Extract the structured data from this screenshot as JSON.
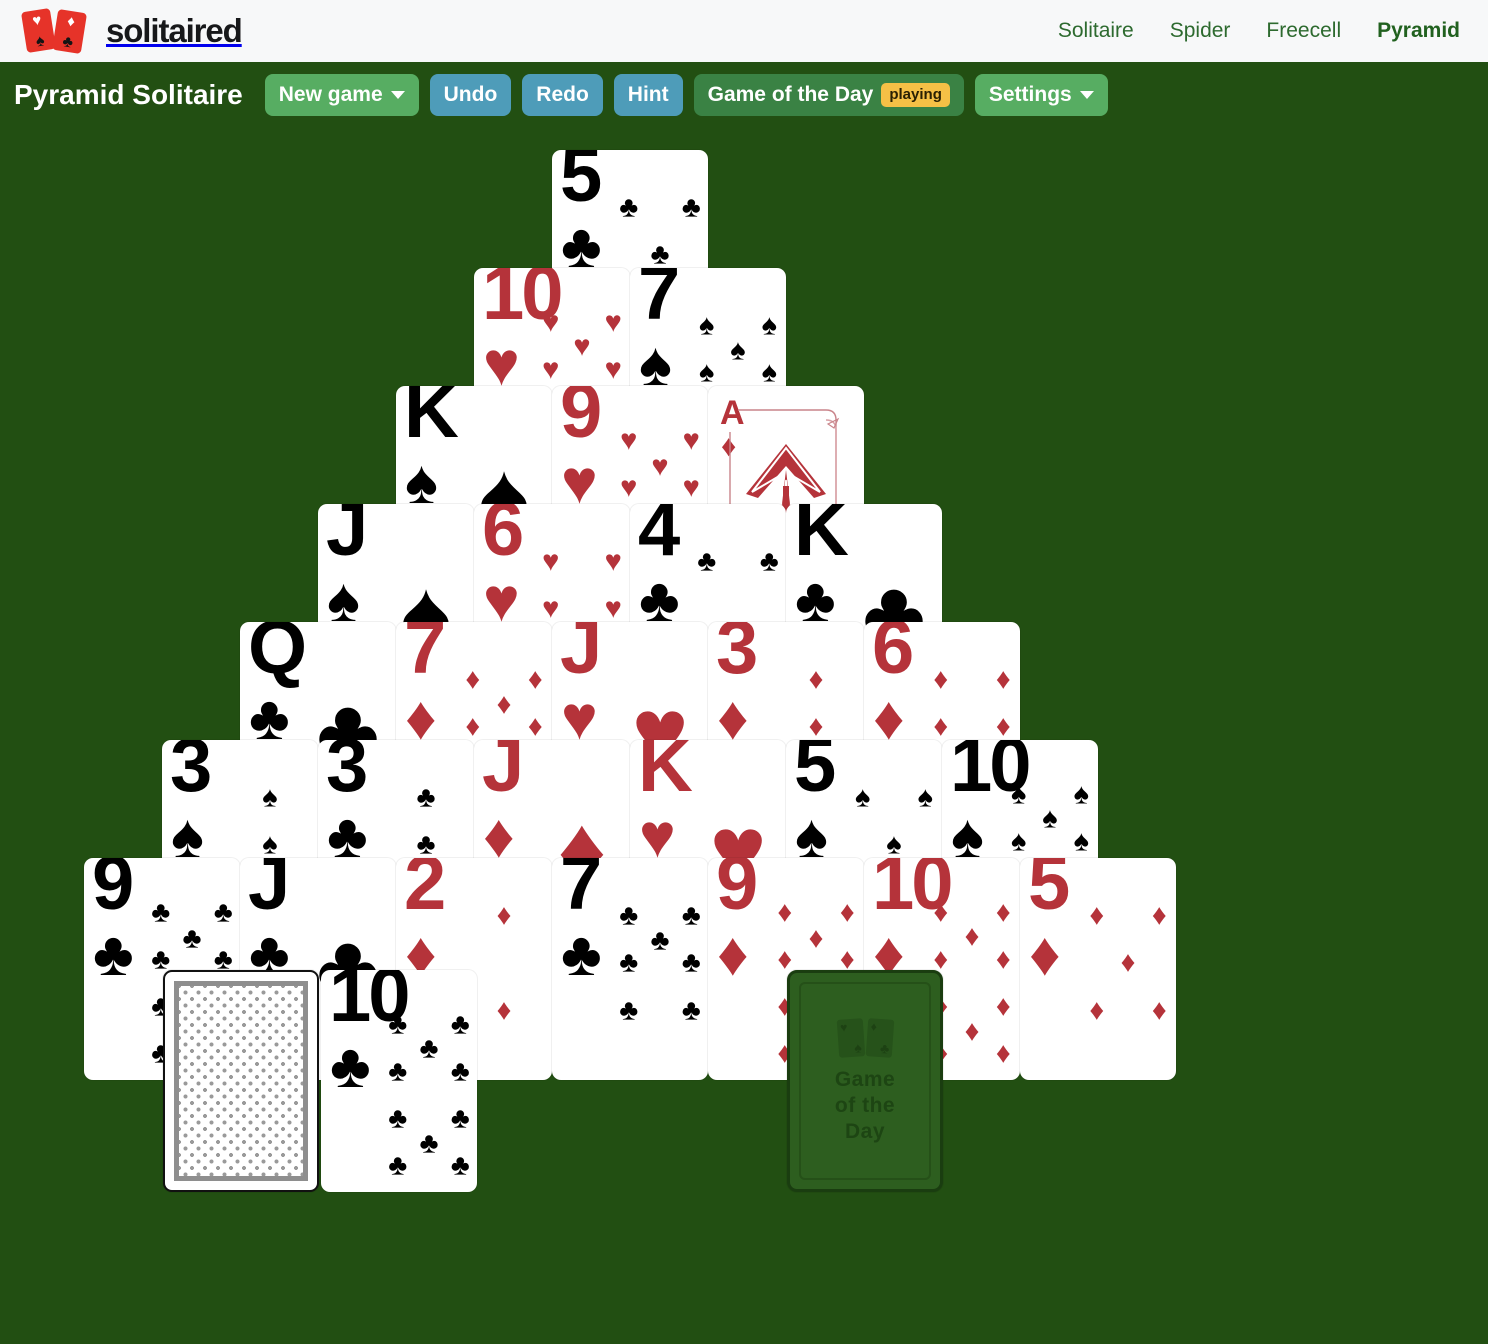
{
  "brand": {
    "name": "solitaired",
    "logo_icon": "two-playing-cards-icon",
    "logo_top_pip": "♥",
    "logo_bottom_pip": "♠",
    "logo_top_pip2": "♦",
    "logo_bottom_pip2": "♣"
  },
  "nav": {
    "links": [
      {
        "label": "Solitaire",
        "active": false
      },
      {
        "label": "Spider",
        "active": false
      },
      {
        "label": "Freecell",
        "active": false
      },
      {
        "label": "Pyramid",
        "active": true
      }
    ]
  },
  "toolbar": {
    "title": "Pyramid Solitaire",
    "new_game_label": "New game",
    "undo_label": "Undo",
    "redo_label": "Redo",
    "hint_label": "Hint",
    "gotd_label": "Game of the Day",
    "gotd_badge": "playing",
    "settings_label": "Settings"
  },
  "colors": {
    "table_green": "#224F12",
    "nav_bg": "#f7f8f9",
    "link_green": "#2d6a2f",
    "btn_green": "#57ad62",
    "btn_green_dark": "#3a8244",
    "btn_blue": "#4e9cb9",
    "badge_yellow": "#f5c046",
    "card_red": "#b5333a",
    "card_black": "#000000",
    "brand_red": "#e63329"
  },
  "game": {
    "type": "pyramid-solitaire",
    "pyramid_rows": 7,
    "rows": [
      [
        {
          "rank": "5",
          "suit": "clubs"
        }
      ],
      [
        {
          "rank": "10",
          "suit": "hearts"
        },
        {
          "rank": "7",
          "suit": "spades"
        }
      ],
      [
        {
          "rank": "K",
          "suit": "spades"
        },
        {
          "rank": "9",
          "suit": "hearts"
        },
        {
          "rank": "A",
          "suit": "diamonds"
        }
      ],
      [
        {
          "rank": "J",
          "suit": "spades"
        },
        {
          "rank": "6",
          "suit": "hearts"
        },
        {
          "rank": "4",
          "suit": "clubs"
        },
        {
          "rank": "K",
          "suit": "clubs"
        }
      ],
      [
        {
          "rank": "Q",
          "suit": "clubs"
        },
        {
          "rank": "7",
          "suit": "diamonds"
        },
        {
          "rank": "J",
          "suit": "hearts"
        },
        {
          "rank": "3",
          "suit": "diamonds"
        },
        {
          "rank": "6",
          "suit": "diamonds"
        }
      ],
      [
        {
          "rank": "3",
          "suit": "spades"
        },
        {
          "rank": "3",
          "suit": "clubs"
        },
        {
          "rank": "J",
          "suit": "diamonds"
        },
        {
          "rank": "K",
          "suit": "hearts"
        },
        {
          "rank": "5",
          "suit": "spades"
        },
        {
          "rank": "10",
          "suit": "spades"
        }
      ],
      [
        {
          "rank": "9",
          "suit": "clubs"
        },
        {
          "rank": "J",
          "suit": "clubs"
        },
        {
          "rank": "2",
          "suit": "diamonds"
        },
        {
          "rank": "7",
          "suit": "clubs"
        },
        {
          "rank": "9",
          "suit": "diamonds"
        },
        {
          "rank": "10",
          "suit": "diamonds"
        },
        {
          "rank": "5",
          "suit": "diamonds"
        }
      ]
    ],
    "stock": {
      "face_down": true,
      "icon": "card-back-icon"
    },
    "waste": {
      "rank": "10",
      "suit": "clubs"
    },
    "gotd_placeholder": {
      "line1": "Game",
      "line2": "of the",
      "line3": "Day"
    }
  },
  "suit_glyphs": {
    "spades": "♠",
    "hearts": "♥",
    "diamonds": "♦",
    "clubs": "♣"
  }
}
